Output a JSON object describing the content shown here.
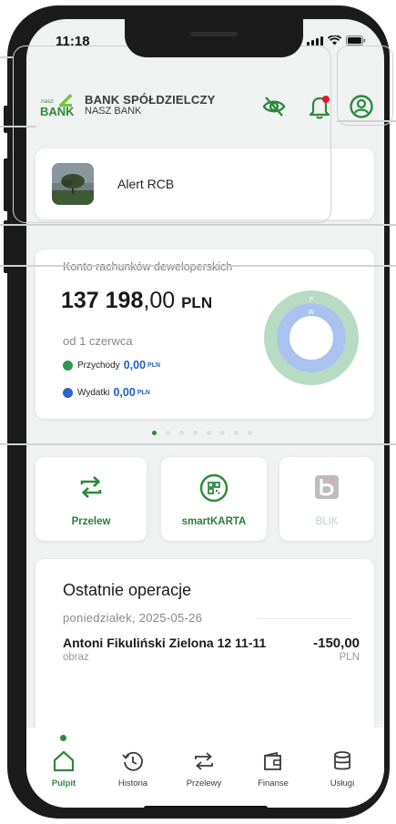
{
  "status": {
    "time": "11:18"
  },
  "header": {
    "logo_small": "nasz",
    "logo_word": "BANK",
    "bank_name": "BANK SPÓŁDZIELCZY",
    "bank_sub": "NASZ BANK",
    "icons": [
      "eye-off-icon",
      "bell-icon",
      "user-circle-icon"
    ],
    "notification_color": "#e4162b"
  },
  "alert": {
    "label": "Alert RCB"
  },
  "account": {
    "title": "Konto rachunków deweloperskich",
    "amount_int": "137 198",
    "amount_dec": ",00",
    "currency": "PLN",
    "since": "od 1 czerwca",
    "income_label": "Przychody",
    "income_value": "0,00",
    "income_currency": "PLN",
    "expense_label": "Wydatki",
    "expense_value": "0,00",
    "expense_currency": "PLN",
    "donut": {
      "outer_label": "P",
      "inner_label": "W",
      "outer_color": "#b7dbc3",
      "inner_color": "#a9c2ee"
    }
  },
  "pager": {
    "pages": 8,
    "active": 1
  },
  "tiles": [
    {
      "label": "Przelew",
      "icon": "transfer-arrows-icon",
      "enabled": true
    },
    {
      "label": "smartKARTA",
      "icon": "qr-card-icon",
      "enabled": true
    },
    {
      "label": "BLIK",
      "icon": "blik-icon",
      "enabled": false
    }
  ],
  "operations": {
    "title": "Ostatnie operacje",
    "date": "poniedziałek, 2025-05-26",
    "items": [
      {
        "name": "Antoni Fikuliński  Zielona 12 11-11",
        "description": "obraz",
        "amount": "-150,00",
        "currency": "PLN"
      }
    ]
  },
  "nav": {
    "items": [
      {
        "label": "Pulpit",
        "icon": "home-icon",
        "active": true
      },
      {
        "label": "Historia",
        "icon": "history-icon",
        "active": false
      },
      {
        "label": "Przelewy",
        "icon": "transfers-icon",
        "active": false
      },
      {
        "label": "Finanse",
        "icon": "wallet-icon",
        "active": false
      },
      {
        "label": "Usługi",
        "icon": "database-icon",
        "active": false
      }
    ]
  },
  "colors": {
    "brand_green": "#2a8a3c",
    "link_blue": "#1f5fc6",
    "background": "#f0f1f1"
  }
}
